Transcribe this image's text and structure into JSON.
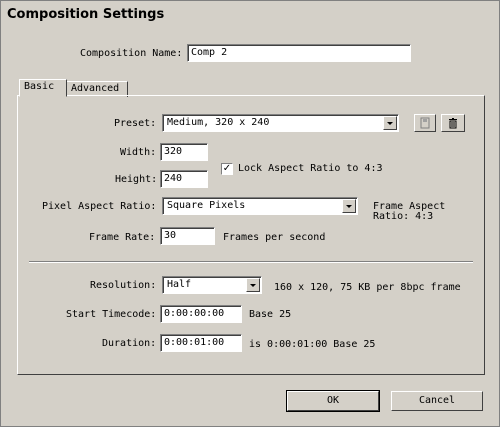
{
  "window": {
    "title": "Composition Settings"
  },
  "composition_name": {
    "label": "Composition Name:",
    "value": "Comp 2"
  },
  "tabs": [
    {
      "label": "Basic"
    },
    {
      "label": "Advanced"
    }
  ],
  "preset": {
    "label": "Preset:",
    "value": "Medium, 320 x 240",
    "icons": [
      "save-preset-icon",
      "trash-icon"
    ]
  },
  "width": {
    "label": "Width:",
    "value": "320"
  },
  "height": {
    "label": "Height:",
    "value": "240"
  },
  "lock_aspect": {
    "label": "Lock Aspect Ratio to 4:3",
    "checked": true
  },
  "pixel_aspect": {
    "label": "Pixel Aspect Ratio:",
    "value": "Square Pixels",
    "frame_aspect_line1": "Frame Aspect",
    "frame_aspect_line2": "Ratio: 4:3"
  },
  "frame_rate": {
    "label": "Frame Rate:",
    "value": "30",
    "unit": "Frames per second"
  },
  "resolution": {
    "label": "Resolution:",
    "value": "Half",
    "info": "160 x 120, 75 KB per 8bpc frame"
  },
  "start_timecode": {
    "label": "Start Timecode:",
    "value": "0:00:00:00",
    "base": "Base 25"
  },
  "duration": {
    "label": "Duration:",
    "value": "0:00:01:00",
    "info": "is 0:00:01:00  Base 25"
  },
  "buttons": {
    "ok": "OK",
    "cancel": "Cancel"
  }
}
